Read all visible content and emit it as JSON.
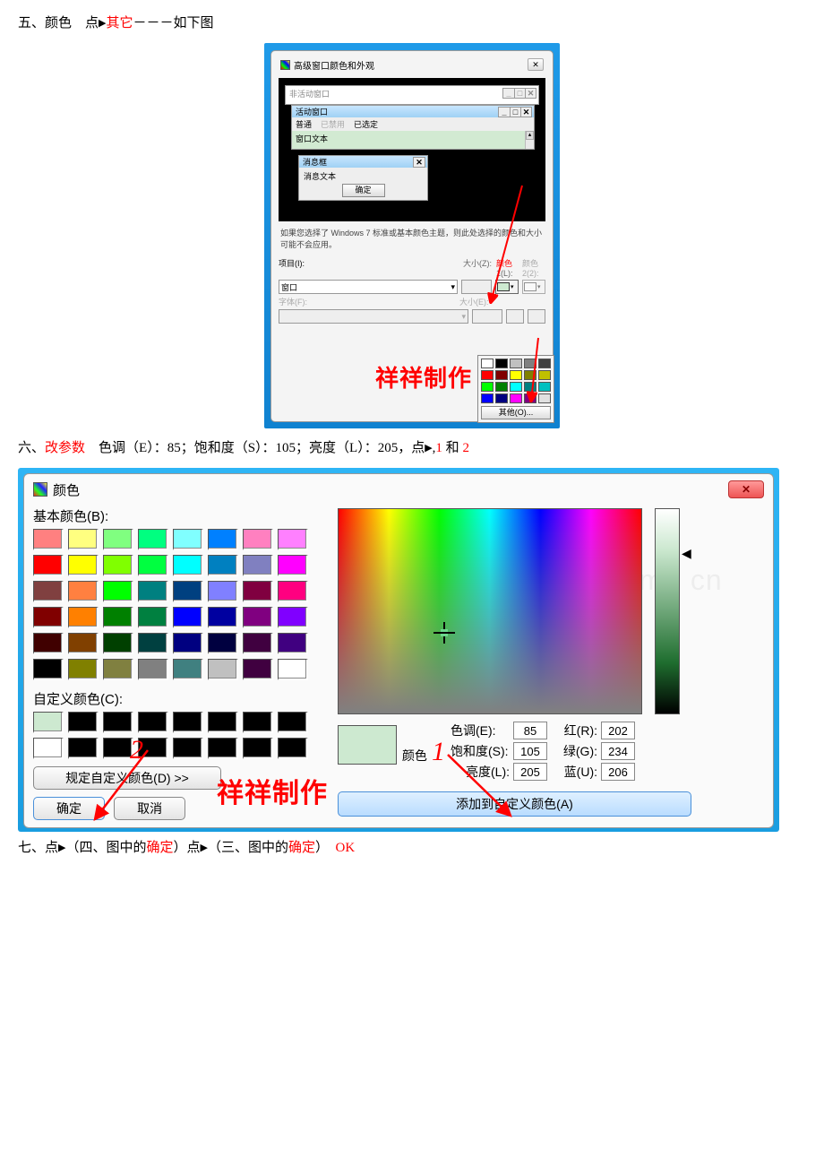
{
  "step5": {
    "prefix": "五、颜色　点",
    "highlight": "其它",
    "suffix": "－－－如下图"
  },
  "win1": {
    "title": "高级窗口颜色和外观",
    "inactive_label": "非活动窗口",
    "active_label": "活动窗口",
    "menu_normal": "普通",
    "menu_disabled": "已禁用",
    "menu_selected": "已选定",
    "window_text": "窗口文本",
    "msgbox_title": "消息框",
    "msgbox_text": "消息文本",
    "msgbox_ok": "确定",
    "advice": "如果您选择了 Windows 7 标准或基本颜色主题，则此处选择的颜色和大小可能不会应用。",
    "item_label": "项目(I):",
    "item_value": "窗口",
    "size_label": "大小(Z):",
    "color1_label": "颜色",
    "color1_sub": "1(L):",
    "color2_label": "颜色",
    "color2_sub": "2(2):",
    "font_label": "字体(F):",
    "sizeE_label": "大小(E):",
    "other_btn": "其他(O)...",
    "watermark": "祥祥制作"
  },
  "step6": {
    "prefix": "六、",
    "highlight": "改参数",
    "mid": "　色调（E）：85；饱和度（S）：105；亮度（L）：205，点",
    "one": "1",
    "and": " 和 ",
    "two": "2"
  },
  "win2": {
    "title": "颜色",
    "basic_label": "基本颜色(B):",
    "custom_label": "自定义颜色(C):",
    "define_btn": "规定自定义颜色(D) >>",
    "ok_btn": "确定",
    "cancel_btn": "取消",
    "hue_label": "色调(E):",
    "sat_label": "饱和度(S):",
    "lum_label": "亮度(L):",
    "red_label": "红(R):",
    "green_label": "绿(G):",
    "blue_label": "蓝(U):",
    "hue": "85",
    "sat": "105",
    "lum": "205",
    "red": "202",
    "green": "234",
    "blue": "206",
    "solid_label": "颜色",
    "add_btn": "添加到自定义颜色(A)",
    "watermark": "祥祥制作",
    "ann1": "1",
    "ann2": "2",
    "faint_wm": "www . zixin . com . cn",
    "basic_colors": [
      "#ff8080",
      "#ffff80",
      "#80ff80",
      "#00ff80",
      "#80ffff",
      "#0080ff",
      "#ff80c0",
      "#ff80ff",
      "#ff0000",
      "#ffff00",
      "#80ff00",
      "#00ff40",
      "#00ffff",
      "#0080c0",
      "#8080c0",
      "#ff00ff",
      "#804040",
      "#ff8040",
      "#00ff00",
      "#008080",
      "#004080",
      "#8080ff",
      "#800040",
      "#ff0080",
      "#800000",
      "#ff8000",
      "#008000",
      "#008040",
      "#0000ff",
      "#0000a0",
      "#800080",
      "#8000ff",
      "#400000",
      "#804000",
      "#004000",
      "#004040",
      "#000080",
      "#000040",
      "#400040",
      "#400080",
      "#000000",
      "#808000",
      "#808040",
      "#808080",
      "#408080",
      "#c0c0c0",
      "#400040",
      "#ffffff"
    ],
    "custom_colors": [
      "#cde9d0",
      "#000000",
      "#000000",
      "#000000",
      "#000000",
      "#000000",
      "#000000",
      "#000000",
      "#ffffff",
      "#000000",
      "#000000",
      "#000000",
      "#000000",
      "#000000",
      "#000000",
      "#000000"
    ]
  },
  "palette_colors": [
    "#ffffff",
    "#000000",
    "#c0c0c0",
    "#808080",
    "#404040",
    "#ff0000",
    "#800000",
    "#ffff00",
    "#808000",
    "#c0c000",
    "#00ff00",
    "#008000",
    "#00ffff",
    "#008080",
    "#00c0c0",
    "#0000ff",
    "#000080",
    "#ff00ff",
    "#800080",
    "#e0e0e0"
  ],
  "step7": {
    "prefix": "七、点",
    "p1_a": "（四、图中的",
    "p1_btn": "确定",
    "p1_b": "）点",
    "p2_a": "（三、图中的",
    "p2_btn": "确定",
    "p2_b": "）　",
    "ok": "OK"
  }
}
